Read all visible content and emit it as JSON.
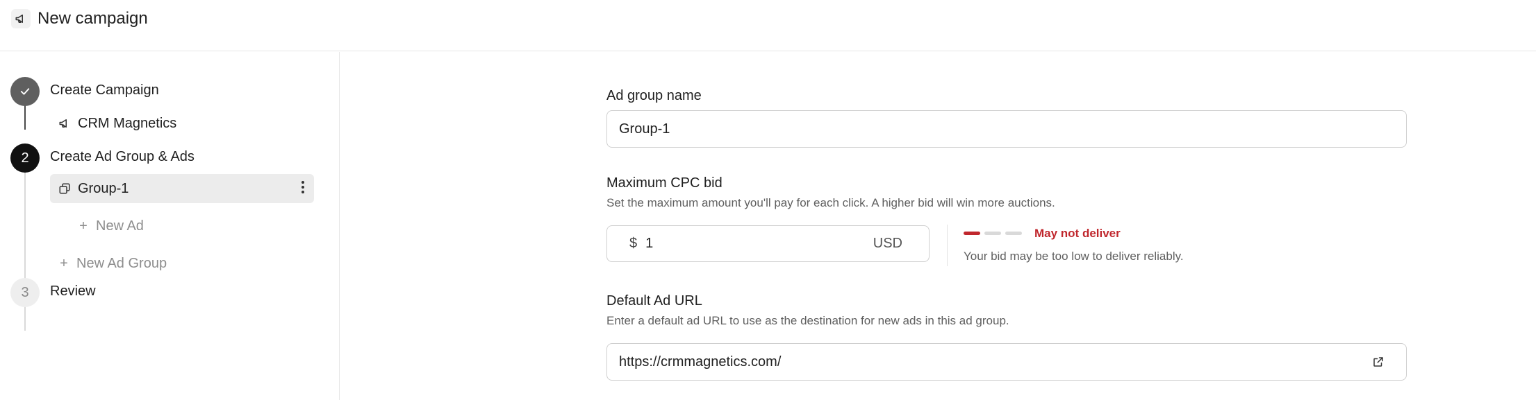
{
  "header": {
    "icon": "megaphone-icon",
    "title": "New campaign"
  },
  "steps": [
    {
      "number": "1",
      "label": "Create Campaign",
      "state": "done",
      "items": [
        {
          "icon": "megaphone-icon",
          "label": "CRM Magnetics"
        }
      ]
    },
    {
      "number": "2",
      "label": "Create Ad Group & Ads",
      "state": "active",
      "items": [
        {
          "icon": "stack-icon",
          "label": "Group-1",
          "selected": true
        },
        {
          "icon": "plus-icon",
          "label": "New Ad"
        },
        {
          "icon": "plus-icon",
          "label": "New Ad Group"
        }
      ]
    },
    {
      "number": "3",
      "label": "Review",
      "state": "pending",
      "items": []
    }
  ],
  "form": {
    "ad_group_name": {
      "label": "Ad group name",
      "value": "Group-1"
    },
    "cpc_bid": {
      "label": "Maximum CPC bid",
      "help": "Set the maximum amount you'll pay for each click. A higher bid will win more auctions.",
      "currency_symbol": "$",
      "value": "1",
      "currency": "USD",
      "strength_level": 1,
      "strength_max": 3,
      "status": "May not deliver",
      "status_help": "Your bid may be too low to deliver reliably."
    },
    "default_url": {
      "label": "Default Ad URL",
      "help": "Enter a default ad URL to use as the destination for new ads in this ad group.",
      "value": "https://crmmagnetics.com/",
      "icon": "external-link-icon"
    }
  },
  "colors": {
    "warning": "#c0272d",
    "active_step": "#111111",
    "done_step": "#5f5f5f",
    "selected_bg": "#ececec"
  }
}
